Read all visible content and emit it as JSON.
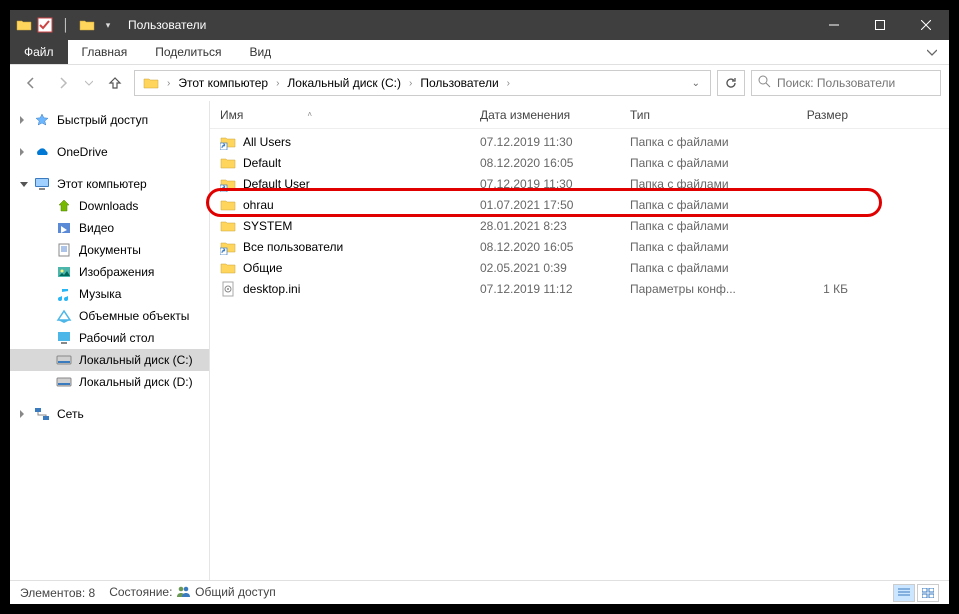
{
  "window": {
    "title": "Пользователи"
  },
  "menubar": {
    "file": "Файл",
    "tabs": [
      "Главная",
      "Поделиться",
      "Вид"
    ]
  },
  "breadcrumb": {
    "parts": [
      "Этот компьютер",
      "Локальный диск (C:)",
      "Пользователи"
    ]
  },
  "search": {
    "placeholder": "Поиск: Пользователи"
  },
  "sidebar": {
    "quick_access": "Быстрый доступ",
    "onedrive": "OneDrive",
    "this_pc": "Этот компьютер",
    "items": [
      {
        "label": "Downloads"
      },
      {
        "label": "Видео"
      },
      {
        "label": "Документы"
      },
      {
        "label": "Изображения"
      },
      {
        "label": "Музыка"
      },
      {
        "label": "Объемные объекты"
      },
      {
        "label": "Рабочий стол"
      },
      {
        "label": "Локальный диск (C:)"
      },
      {
        "label": "Локальный диск (D:)"
      }
    ],
    "network": "Сеть"
  },
  "columns": {
    "name": "Имя",
    "date": "Дата изменения",
    "type": "Тип",
    "size": "Размер"
  },
  "rows": [
    {
      "icon": "folder-shortcut",
      "name": "All Users",
      "date": "07.12.2019 11:30",
      "type": "Папка с файлами",
      "size": ""
    },
    {
      "icon": "folder",
      "name": "Default",
      "date": "08.12.2020 16:05",
      "type": "Папка с файлами",
      "size": ""
    },
    {
      "icon": "folder-shortcut",
      "name": "Default User",
      "date": "07.12.2019 11:30",
      "type": "Папка с файлами",
      "size": ""
    },
    {
      "icon": "folder",
      "name": "ohrau",
      "date": "01.07.2021 17:50",
      "type": "Папка с файлами",
      "size": "",
      "highlight": true
    },
    {
      "icon": "folder",
      "name": "SYSTEM",
      "date": "28.01.2021 8:23",
      "type": "Папка с файлами",
      "size": ""
    },
    {
      "icon": "folder-shortcut",
      "name": "Все пользователи",
      "date": "08.12.2020 16:05",
      "type": "Папка с файлами",
      "size": ""
    },
    {
      "icon": "folder",
      "name": "Общие",
      "date": "02.05.2021 0:39",
      "type": "Папка с файлами",
      "size": ""
    },
    {
      "icon": "ini",
      "name": "desktop.ini",
      "date": "07.12.2019 11:12",
      "type": "Параметры конф...",
      "size": "1 КБ"
    }
  ],
  "status": {
    "count": "Элементов: 8",
    "state_label": "Состояние:",
    "state_value": "Общий доступ"
  }
}
